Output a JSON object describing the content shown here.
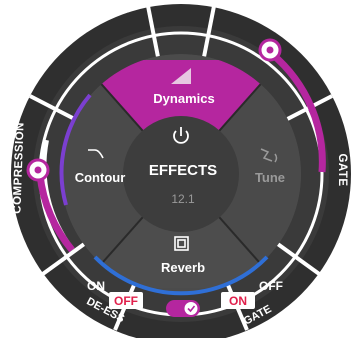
{
  "center": {
    "title": "EFFECTS",
    "value": "12.1",
    "power_icon": "power-icon"
  },
  "segments": {
    "dynamics": {
      "label": "Dynamics",
      "icon": "dynamics-ramp-icon",
      "active": true
    },
    "tune": {
      "label": "Tune",
      "icon": "tune-icon",
      "active": false
    },
    "reverb": {
      "label": "Reverb",
      "icon": "reverb-square-icon",
      "active": false
    },
    "contour": {
      "label": "Contour",
      "icon": "contour-curve-icon",
      "active": false
    }
  },
  "rings": {
    "compression": {
      "label": "COMPRESSION",
      "level": 0.55
    },
    "gate": {
      "label": "GATE",
      "level": 0.25
    }
  },
  "toggles": {
    "deess": {
      "label": "DE-ESS",
      "on": "ON",
      "off": "OFF",
      "state": "OFF"
    },
    "gate": {
      "label": "GATE",
      "on": "ON",
      "off": "OFF",
      "state": "ON"
    }
  },
  "bottom_switch": {
    "icon": "check-icon",
    "state": "on"
  },
  "colors": {
    "accent": "#b5269f",
    "ring_dark": "#3a3a3a",
    "segment_dark": "#4b4b4b",
    "center": "#3d3d3d",
    "blue_arc": "#2f6fd6",
    "purple_arc": "#7b3fd0",
    "off_red": "#e0204b"
  }
}
